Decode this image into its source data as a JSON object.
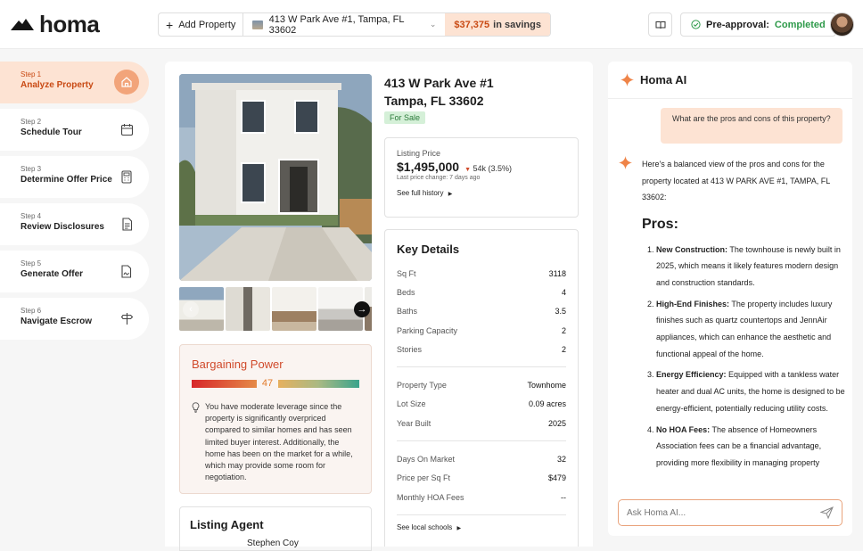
{
  "brand": {
    "name": "homa"
  },
  "topbar": {
    "add_property": "Add Property",
    "address": "413 W Park Ave #1, Tampa, FL 33602",
    "savings_amount": "$37,375",
    "savings_suffix": "in savings",
    "preapproval_label": "Pre-approval:",
    "preapproval_status": "Completed"
  },
  "steps": [
    {
      "num": "Step 1",
      "title": "Analyze Property",
      "icon": "home-icon"
    },
    {
      "num": "Step 2",
      "title": "Schedule Tour",
      "icon": "calendar-icon"
    },
    {
      "num": "Step 3",
      "title": "Determine Offer Price",
      "icon": "calculator-icon"
    },
    {
      "num": "Step 4",
      "title": "Review Disclosures",
      "icon": "document-icon"
    },
    {
      "num": "Step 5",
      "title": "Generate Offer",
      "icon": "signed-document-icon"
    },
    {
      "num": "Step 6",
      "title": "Navigate Escrow",
      "icon": "signpost-icon"
    }
  ],
  "property": {
    "title_line1": "413 W Park Ave #1",
    "title_line2": "Tampa, FL 33602",
    "status": "For Sale",
    "listing_price_label": "Listing Price",
    "listing_price": "$1,495,000",
    "price_drop": "54k (3.5%)",
    "last_change": "Last price change: 7 days ago",
    "history_link": "See full history"
  },
  "key_details": {
    "title": "Key Details",
    "group1": [
      {
        "k": "Sq Ft",
        "v": "3118"
      },
      {
        "k": "Beds",
        "v": "4"
      },
      {
        "k": "Baths",
        "v": "3.5"
      },
      {
        "k": "Parking Capacity",
        "v": "2"
      },
      {
        "k": "Stories",
        "v": "2"
      }
    ],
    "group2": [
      {
        "k": "Property Type",
        "v": "Townhome"
      },
      {
        "k": "Lot Size",
        "v": "0.09 acres"
      },
      {
        "k": "Year Built",
        "v": "2025"
      }
    ],
    "group3": [
      {
        "k": "Days On Market",
        "v": "32"
      },
      {
        "k": "Price per Sq Ft",
        "v": "$479"
      },
      {
        "k": "Monthly HOA Fees",
        "v": "--"
      }
    ],
    "schools_link": "See local schools"
  },
  "bargaining": {
    "title": "Bargaining Power",
    "score": "47",
    "text": "You have moderate leverage since the property is significantly overpriced compared to similar homes and has seen limited buyer interest. Additionally, the home has been on the market for a while, which may provide some room for negotiation."
  },
  "agent": {
    "title": "Listing Agent",
    "name": "Stephen Coy"
  },
  "ai": {
    "title": "Homa AI",
    "question": "What are the pros and cons of this property?",
    "intro": "Here's a balanced view of the pros and cons for the property located at 413 W PARK AVE #1, TAMPA, FL 33602:",
    "pros_heading": "Pros:",
    "pros": [
      {
        "label": "New Construction:",
        "text": " The townhouse is newly built in 2025, which means it likely features modern design and construction standards."
      },
      {
        "label": "High-End Finishes:",
        "text": " The property includes luxury finishes such as quartz countertops and JennAir appliances, which can enhance the aesthetic and functional appeal of the home."
      },
      {
        "label": "Energy Efficiency:",
        "text": " Equipped with a tankless water heater and dual AC units, the home is designed to be energy-efficient, potentially reducing utility costs."
      },
      {
        "label": "No HOA Fees:",
        "text": " The absence of Homeowners Association fees can be a financial advantage, providing more flexibility in managing property"
      }
    ],
    "input_placeholder": "Ask Homa AI..."
  },
  "colors": {
    "accent": "#c94a14",
    "accent_bg": "#fde3d3",
    "success": "#2e9a4a"
  }
}
